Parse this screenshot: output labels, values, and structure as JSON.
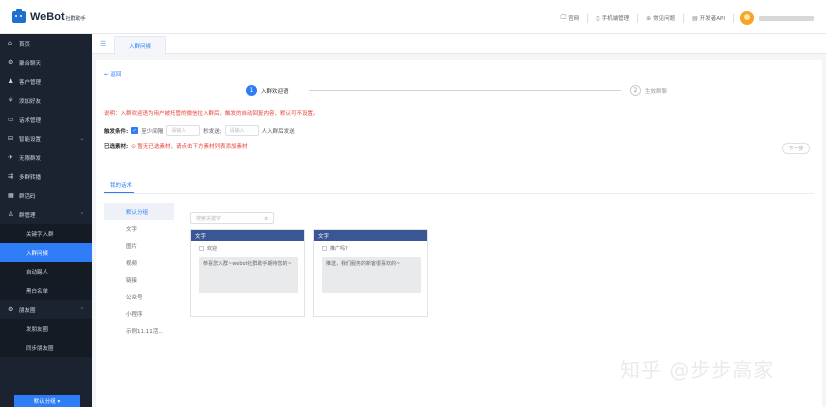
{
  "brand": {
    "name": "WeBot",
    "sub": "社群助手"
  },
  "topbar": {
    "links": [
      {
        "icon": "🖵",
        "label": "官网"
      },
      {
        "icon": "▯",
        "label": "手机端管理"
      },
      {
        "icon": "⊕",
        "label": "常见问题"
      },
      {
        "icon": "▤",
        "label": "开发者API"
      }
    ]
  },
  "sidebar": {
    "items": [
      {
        "icon": "⌂",
        "label": "首页"
      },
      {
        "icon": "⚙",
        "label": "聚合聊天"
      },
      {
        "icon": "♟",
        "label": "客户管理"
      },
      {
        "icon": "⚘",
        "label": "添加好友"
      },
      {
        "icon": "▭",
        "label": "话术管理"
      },
      {
        "icon": "⊟",
        "label": "智能设置",
        "caret": "⌄"
      },
      {
        "icon": "✈",
        "label": "无限群发"
      },
      {
        "icon": "⇶",
        "label": "多群转播"
      },
      {
        "icon": "▦",
        "label": "群活码"
      }
    ],
    "group_qun": {
      "icon": "♙",
      "label": "群管理",
      "caret": "⌃"
    },
    "qun_sub": [
      "关键字入群",
      "入群问候",
      "自动踢人",
      "黑白名单"
    ],
    "group_moments": {
      "icon": "⚙",
      "label": "朋友圈",
      "caret": "⌃"
    },
    "moments_sub": [
      "发朋友圈",
      "同步朋友圈"
    ],
    "bottom_label": "默认分组 ▾"
  },
  "tabs": {
    "menu_icon": "☰",
    "active": "入群问候"
  },
  "main": {
    "back": "← 返回",
    "step1": {
      "num": "1",
      "label": "入群欢迎语"
    },
    "step2": {
      "num": "2",
      "label": "生效群聊"
    },
    "note": "说明：入群欢迎语为用户被托管的微信拉入群后，触发的自动回复内容，默认可不设置。",
    "cond_label": "触发条件:",
    "cond_check": "✓",
    "cond_pre": "至少间隔",
    "cond_input1": "请输入",
    "cond_mid": "秒发送;",
    "cond_input2": "请输入",
    "cond_post": "人入群后发送",
    "material_label": "已选素材:",
    "material_warn": "⊙ 暂无已选素材，请点击下方素材列表添加素材",
    "next": "下一步"
  },
  "library": {
    "tab": "我的话术",
    "categories": [
      "默认分组",
      "文字",
      "图片",
      "视频",
      "链接",
      "公众号",
      "小程序",
      "示例11.11活..."
    ],
    "search_placeholder": "搜索关键字",
    "search_icon": "⌕",
    "cards": [
      {
        "type": "文字",
        "name": "欢迎",
        "body": "恭喜您入群~webot社群助手期待您的~"
      },
      {
        "type": "文字",
        "name": "推广吗?",
        "body": "推送，我们服务的新客很喜欢的~"
      }
    ]
  },
  "watermark": "知乎 @步步高家"
}
